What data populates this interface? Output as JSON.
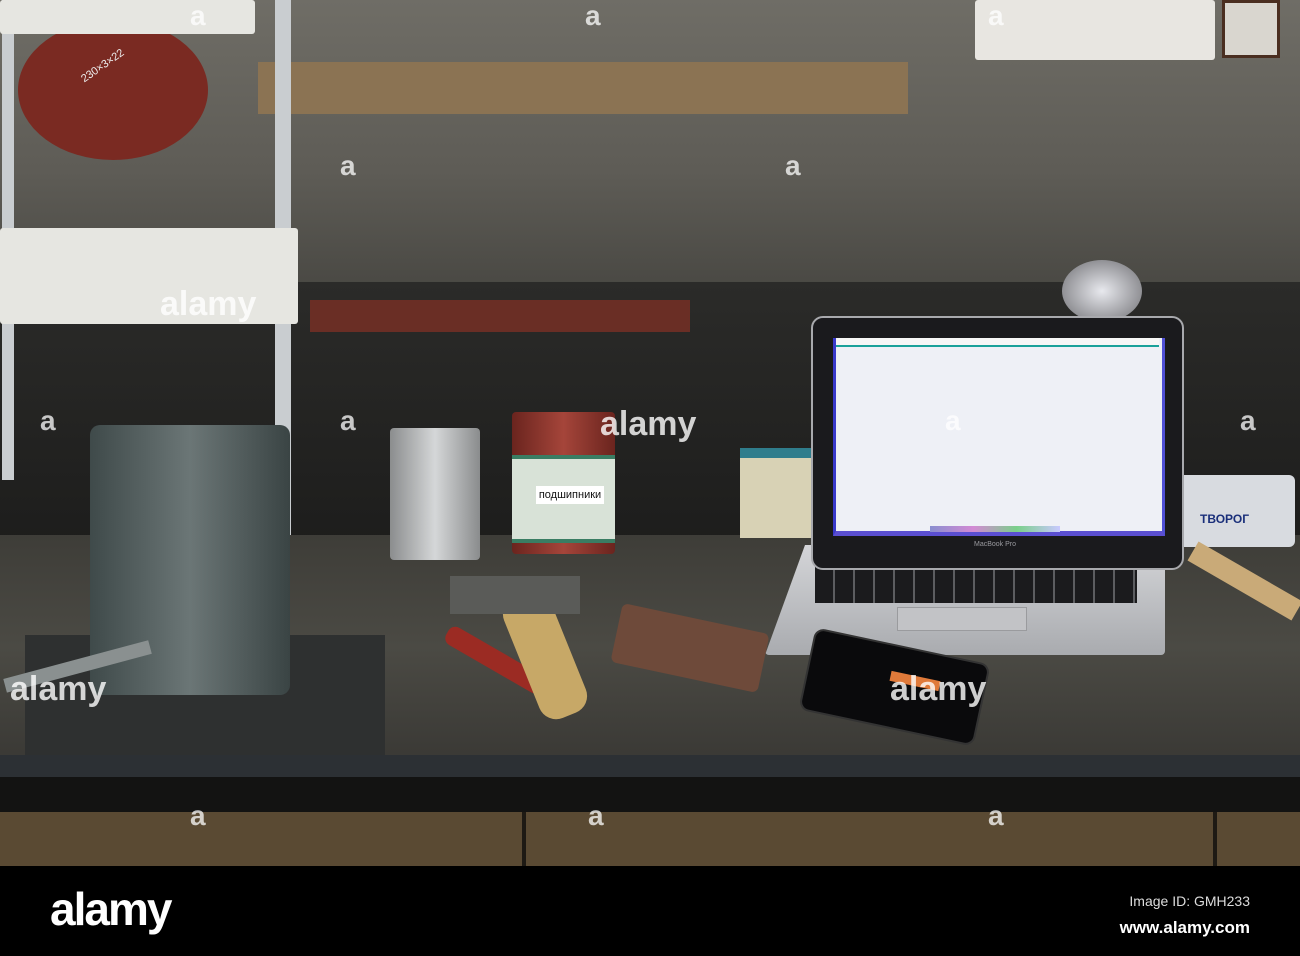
{
  "scene": {
    "description_labels": {
      "can_label": "подшипники",
      "laptop_brand": "MacBook Pro",
      "tub_label": "ТВОРОГ",
      "disc_label": "230×3×22"
    }
  },
  "watermark": {
    "glyph": "a",
    "center_text": "alamy"
  },
  "footer": {
    "logo": "alamy",
    "image_id": "Image ID: GMH233",
    "url": "www.alamy.com"
  },
  "colors": {
    "screen": "#eef0f6",
    "footer_bg": "#000000"
  }
}
